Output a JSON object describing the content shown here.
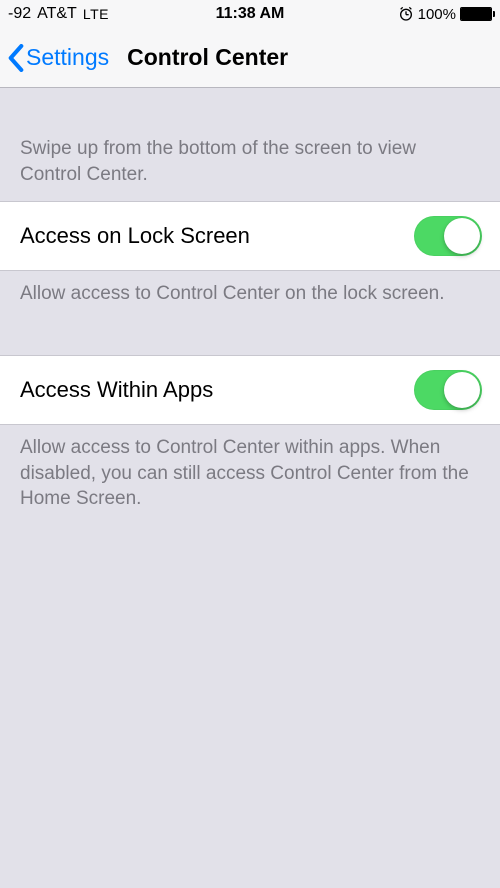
{
  "status": {
    "signal": "-92",
    "carrier": "AT&T",
    "network": "LTE",
    "time": "11:38 AM",
    "battery_pct": "100%"
  },
  "nav": {
    "back_label": "Settings",
    "title": "Control Center"
  },
  "header_text": "Swipe up from the bottom of the screen to view Control Center.",
  "rows": {
    "lock": {
      "label": "Access on Lock Screen",
      "footer": "Allow access to Control Center on the lock screen.",
      "on": true
    },
    "apps": {
      "label": "Access Within Apps",
      "footer": "Allow access to Control Center within apps. When disabled, you can still access Control Center from the Home Screen.",
      "on": true
    }
  },
  "colors": {
    "toggle_on": "#4cd964",
    "tint": "#007aff"
  }
}
